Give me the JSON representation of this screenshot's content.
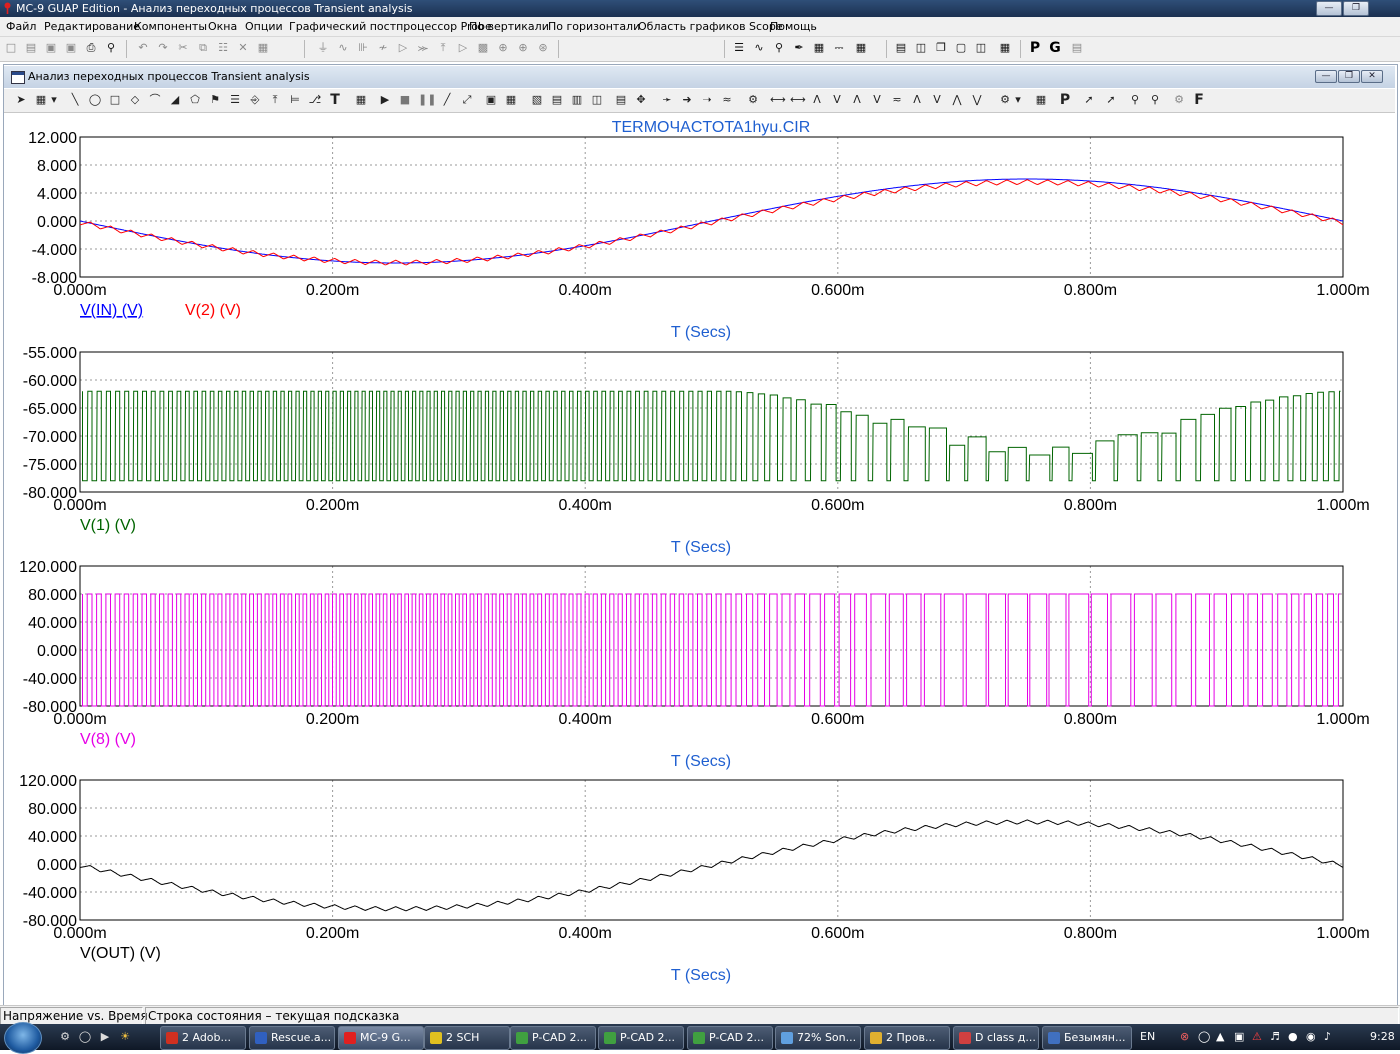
{
  "window": {
    "title": "MC-9 GUAP Edition - Анализ переходных процессов Transient analysis"
  },
  "menu": [
    "Файл",
    "Редактирование",
    "Компоненты",
    "Окна",
    "Опции",
    "Графический постпроцессор Probe",
    "По вертикали",
    "По горизонтали",
    "Область графиков Scope",
    "Помощь"
  ],
  "toolbar": {
    "p_label": "P",
    "g_label": "G"
  },
  "child_window": {
    "title": "Анализ переходных процессов Transient analysis",
    "f_label": "F",
    "t_label": "T"
  },
  "chart_data": [
    {
      "type": "line",
      "title": "TERMOЧACTOTA1hyu.CIR",
      "xlabel": "T (Secs)",
      "ylabel": "",
      "xlim": [
        0,
        1
      ],
      "ylim": [
        -8,
        12
      ],
      "grid": true,
      "x_ticks": [
        "0.000m",
        "0.200m",
        "0.400m",
        "0.600m",
        "0.800m",
        "1.000m"
      ],
      "y_ticks": [
        "12.000",
        "8.000",
        "4.000",
        "0.000",
        "-4.000",
        "-8.000"
      ],
      "series": [
        {
          "name": "V(IN) (V)",
          "color": "#0000ff",
          "underline": true,
          "shape": "sine",
          "amplitude": 6.0,
          "offset": 0,
          "x": [
            0,
            0.125,
            0.25,
            0.375,
            0.5,
            0.625,
            0.75,
            0.875,
            1.0
          ],
          "y": [
            0,
            -4.24,
            -6.0,
            -4.24,
            0,
            4.24,
            6.0,
            4.24,
            0
          ]
        },
        {
          "name": "V(2) (V)",
          "color": "#ff0000",
          "underline": false,
          "shape": "sine-ripple",
          "amplitude": 5.75,
          "offset": -0.2,
          "ripple": 0.35,
          "x": [
            0,
            0.125,
            0.25,
            0.375,
            0.5,
            0.625,
            0.75,
            0.875,
            1.0
          ],
          "y": [
            -0.2,
            -4.3,
            -6.0,
            -4.3,
            -0.2,
            3.9,
            5.5,
            3.9,
            -0.2
          ]
        }
      ]
    },
    {
      "type": "line",
      "title": "",
      "xlabel": "T (Secs)",
      "ylabel": "",
      "xlim": [
        0,
        1
      ],
      "ylim": [
        -80,
        -55
      ],
      "grid": true,
      "x_ticks": [
        "0.000m",
        "0.200m",
        "0.400m",
        "0.600m",
        "0.800m",
        "1.000m"
      ],
      "y_ticks": [
        "-55.000",
        "-60.000",
        "-65.000",
        "-70.000",
        "-75.000",
        "-80.000"
      ],
      "series": [
        {
          "name": "V(1) (V)",
          "color": "#006400",
          "underline": false,
          "shape": "pulses-inverted",
          "low": -78,
          "high": -62,
          "x": [
            0,
            0.25,
            0.5,
            0.75,
            1.0
          ],
          "y": [
            -62,
            -78,
            -62,
            -62,
            -62
          ]
        }
      ]
    },
    {
      "type": "line",
      "title": "",
      "xlabel": "T (Secs)",
      "ylabel": "",
      "xlim": [
        0,
        1
      ],
      "ylim": [
        -80,
        120
      ],
      "grid": true,
      "x_ticks": [
        "0.000m",
        "0.200m",
        "0.400m",
        "0.600m",
        "0.800m",
        "1.000m"
      ],
      "y_ticks": [
        "120.000",
        "80.000",
        "40.000",
        "0.000",
        "-40.000",
        "-80.000"
      ],
      "series": [
        {
          "name": "V(8) (V)",
          "color": "#e600e6",
          "underline": false,
          "shape": "pwm",
          "low": -80,
          "high": 80,
          "x": [
            0,
            0.25,
            0.5,
            0.75,
            1.0
          ],
          "y": [
            80,
            -80,
            80,
            80,
            80
          ]
        }
      ]
    },
    {
      "type": "line",
      "title": "",
      "xlabel": "T (Secs)",
      "ylabel": "",
      "xlim": [
        0,
        1
      ],
      "ylim": [
        -80,
        120
      ],
      "grid": true,
      "x_ticks": [
        "0.000m",
        "0.200m",
        "0.400m",
        "0.600m",
        "0.800m",
        "1.000m"
      ],
      "y_ticks": [
        "120.000",
        "80.000",
        "40.000",
        "0.000",
        "-40.000",
        "-80.000"
      ],
      "series": [
        {
          "name": "V(OUT) (V)",
          "color": "#000000",
          "underline": false,
          "shape": "sine-ripple",
          "amplitude": 62,
          "offset": -2,
          "ripple": 3,
          "x": [
            0,
            0.125,
            0.25,
            0.375,
            0.5,
            0.625,
            0.75,
            0.875,
            1.0
          ],
          "y": [
            -2,
            -46,
            -64,
            -46,
            -2,
            42,
            60,
            42,
            -2
          ]
        }
      ]
    }
  ],
  "status": {
    "left": "Напряжение vs. Время",
    "right": "Строка состояния – текущая подсказка"
  },
  "taskbar": {
    "tasks": [
      "2 Adob...",
      "Rescue.a...",
      "MC-9 G...",
      "2 SCH",
      "P-CAD 2...",
      "P-CAD 2...",
      "P-CAD 2...",
      "72% Son...",
      "2 Пров...",
      "D class д...",
      "Безымян..."
    ],
    "lang": "EN",
    "clock": "9:28"
  }
}
